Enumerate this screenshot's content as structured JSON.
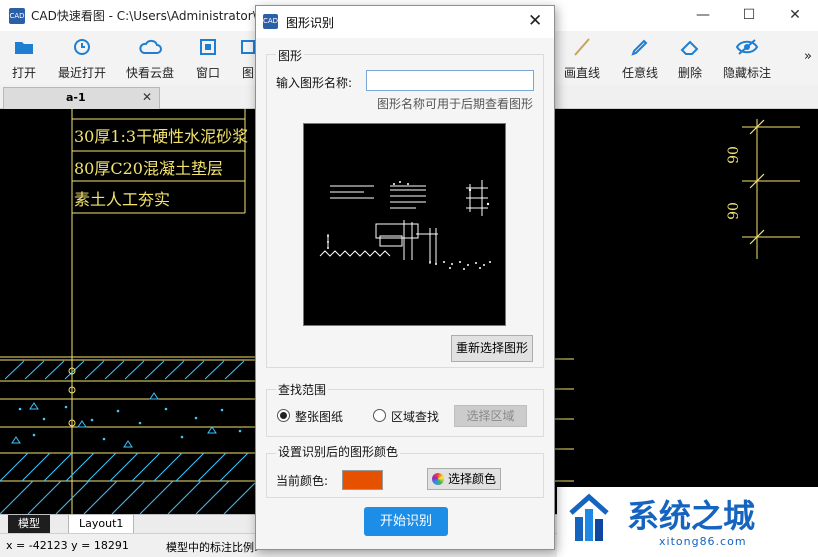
{
  "app": {
    "icon_text": "CAD",
    "title": "CAD快速看图 - C:\\Users\\Administrator\\"
  },
  "window_controls": {
    "minimize": "—",
    "maximize": "☐",
    "close": "✕"
  },
  "toolbar": {
    "left": [
      {
        "label": "打开",
        "icon": "folder-icon"
      },
      {
        "label": "最近打开",
        "icon": "clock-icon"
      },
      {
        "label": "快看云盘",
        "icon": "cloud-icon"
      },
      {
        "label": "窗口",
        "icon": "window-icon"
      },
      {
        "label": "图",
        "icon": "image-icon"
      }
    ],
    "right": [
      {
        "label": "画直线",
        "icon": "line-icon"
      },
      {
        "label": "任意线",
        "icon": "pen-icon"
      },
      {
        "label": "删除",
        "icon": "eraser-icon"
      },
      {
        "label": "隐藏标注",
        "icon": "eye-icon"
      }
    ],
    "more": "»"
  },
  "document_tab": {
    "label": "a-1",
    "close": "✕"
  },
  "drawing": {
    "texts": [
      "30厚1:3干硬性水泥砂浆",
      "80厚C20混凝土垫层",
      "素土人工夯实"
    ],
    "dims": [
      "90",
      "90"
    ]
  },
  "bottom_tabs": [
    "模型",
    "Layout1"
  ],
  "status": {
    "coords": "x = -42123  y = 18291",
    "message": "模型中的标注比例:"
  },
  "dialog": {
    "icon_text": "CAD",
    "title": "图形识别",
    "close": "✕",
    "shape_group": {
      "title": "图形",
      "name_label": "输入图形名称:",
      "name_value": "",
      "hint": "图形名称可用于后期查看图形",
      "reselect_button": "重新选择图形"
    },
    "search_group": {
      "title": "查找范围",
      "options": [
        {
          "label": "整张图纸",
          "selected": true
        },
        {
          "label": "区域查找",
          "selected": false
        }
      ],
      "select_area_button": "选择区域"
    },
    "color_group": {
      "title": "设置识别后的图形颜色",
      "current_label": "当前颜色:",
      "current_color": "#e65100",
      "choose_button": "选择颜色"
    },
    "start_button": "开始识别"
  },
  "watermark": {
    "title": "系统之城",
    "url": "xitong86.com"
  },
  "colors": {
    "accent": "#1c8ee8",
    "cad_yellow": "#f3e36b",
    "cad_cyan": "#3ec5ff"
  }
}
